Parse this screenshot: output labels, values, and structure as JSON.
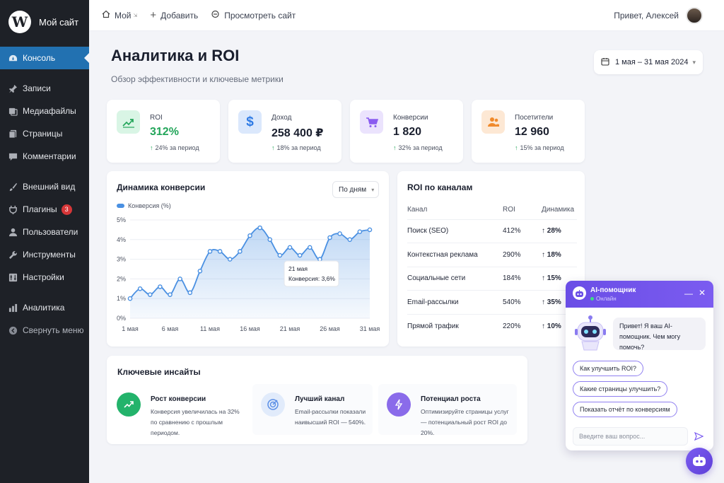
{
  "sidebar": {
    "site_name": "Мой сайт",
    "items": [
      {
        "label": "Консоль",
        "icon": "dashboard-icon"
      },
      {
        "label": "Записи",
        "icon": "pin-icon"
      },
      {
        "label": "Медиафайлы",
        "icon": "media-icon"
      },
      {
        "label": "Страницы",
        "icon": "pages-icon"
      },
      {
        "label": "Комментарии",
        "icon": "comments-icon"
      },
      {
        "label": "Внешний вид",
        "icon": "brush-icon"
      },
      {
        "label": "Плагины",
        "icon": "plugin-icon",
        "badge": "3"
      },
      {
        "label": "Пользователи",
        "icon": "user-icon"
      },
      {
        "label": "Инструменты",
        "icon": "wrench-icon"
      },
      {
        "label": "Настройки",
        "icon": "settings-icon"
      },
      {
        "label": "Аналитика",
        "icon": "analytics-icon"
      },
      {
        "label": "Свернуть меню",
        "icon": "collapse-icon"
      }
    ]
  },
  "topbar": {
    "home_label": "Мой",
    "add_label": "Добавить",
    "view_label": "Просмотреть сайт",
    "greeting": "Привет, Алексей"
  },
  "header": {
    "title": "Аналитика и ROI",
    "subtitle": "Обзор эффективности и ключевые метрики",
    "date_range": "1 мая – 31 мая 2024"
  },
  "kpis": [
    {
      "label": "ROI",
      "value": "312%",
      "delta": "24% за период",
      "color": "#23a55a"
    },
    {
      "label": "Доход",
      "value": "258 400 ₽",
      "delta": "18% за период",
      "color": "#2f7be5"
    },
    {
      "label": "Конверсии",
      "value": "1 820",
      "delta": "32% за период",
      "color": "#8a5cf0"
    },
    {
      "label": "Посетители",
      "value": "12 960",
      "delta": "15% за период",
      "color": "#f08a2c"
    }
  ],
  "conversion_card": {
    "title": "Динамика конверсии",
    "select_value": "По дням",
    "tooltip_date": "21 мая",
    "tooltip_value": "Конверсия: 3,6%"
  },
  "chart_data": {
    "type": "area",
    "series": [
      {
        "name": "Конверсия (%)",
        "values": [
          1.0,
          1.5,
          1.2,
          1.6,
          1.2,
          2.0,
          1.3,
          2.4,
          3.4,
          3.4,
          3.0,
          3.4,
          4.2,
          4.6,
          4.0,
          3.2,
          3.6,
          3.2,
          3.6,
          3.0,
          4.1,
          4.3,
          4.0,
          4.4,
          4.5
        ]
      }
    ],
    "x_ticks": [
      "1 мая",
      "6 мая",
      "11 мая",
      "16 мая",
      "21 мая",
      "26 мая",
      "31 мая"
    ],
    "y_ticks": [
      "0%",
      "1%",
      "2%",
      "3%",
      "4%",
      "5%"
    ],
    "ylim": [
      0,
      5
    ],
    "grid": true,
    "color": "#4a90e2"
  },
  "roi": {
    "title": "ROI по каналам",
    "headers": [
      "Канал",
      "ROI",
      "Динамика"
    ],
    "rows": [
      {
        "channel": "Поиск (SEO)",
        "roi": "412%",
        "trend": "↑ 28%"
      },
      {
        "channel": "Контекстная реклама",
        "roi": "290%",
        "trend": "↑ 18%"
      },
      {
        "channel": "Социальные сети",
        "roi": "184%",
        "trend": "↑ 15%"
      },
      {
        "channel": "Email-рассылки",
        "roi": "540%",
        "trend": "↑ 35%"
      },
      {
        "channel": "Прямой трафик",
        "roi": "220%",
        "trend": "↑ 10%"
      }
    ]
  },
  "insights": {
    "title": "Ключевые инсайты",
    "items": [
      {
        "heading": "Рост конверсии",
        "text": "Конверсия увеличилась на 32% по сравнению с прошлым периодом.",
        "color": "#23b36b"
      },
      {
        "heading": "Лучший канал",
        "text": "Email-рассылки показали наивысший ROI — 540%.",
        "color": "#5b8fe6"
      },
      {
        "heading": "Потенциал роста",
        "text": "Оптимизируйте страницы услуг — потенциальный рост ROI до 20%.",
        "color": "#8a6bea"
      }
    ]
  },
  "ai": {
    "name": "AI-помощник",
    "status": "Онлайн",
    "message": "Привет! Я ваш AI-помощник. Чем могу помочь?",
    "chips": [
      "Как улучшить ROI?",
      "Какие страницы улучшить?",
      "Показать отчёт по конверсиям"
    ],
    "input_placeholder": "Введите ваш вопрос..."
  }
}
